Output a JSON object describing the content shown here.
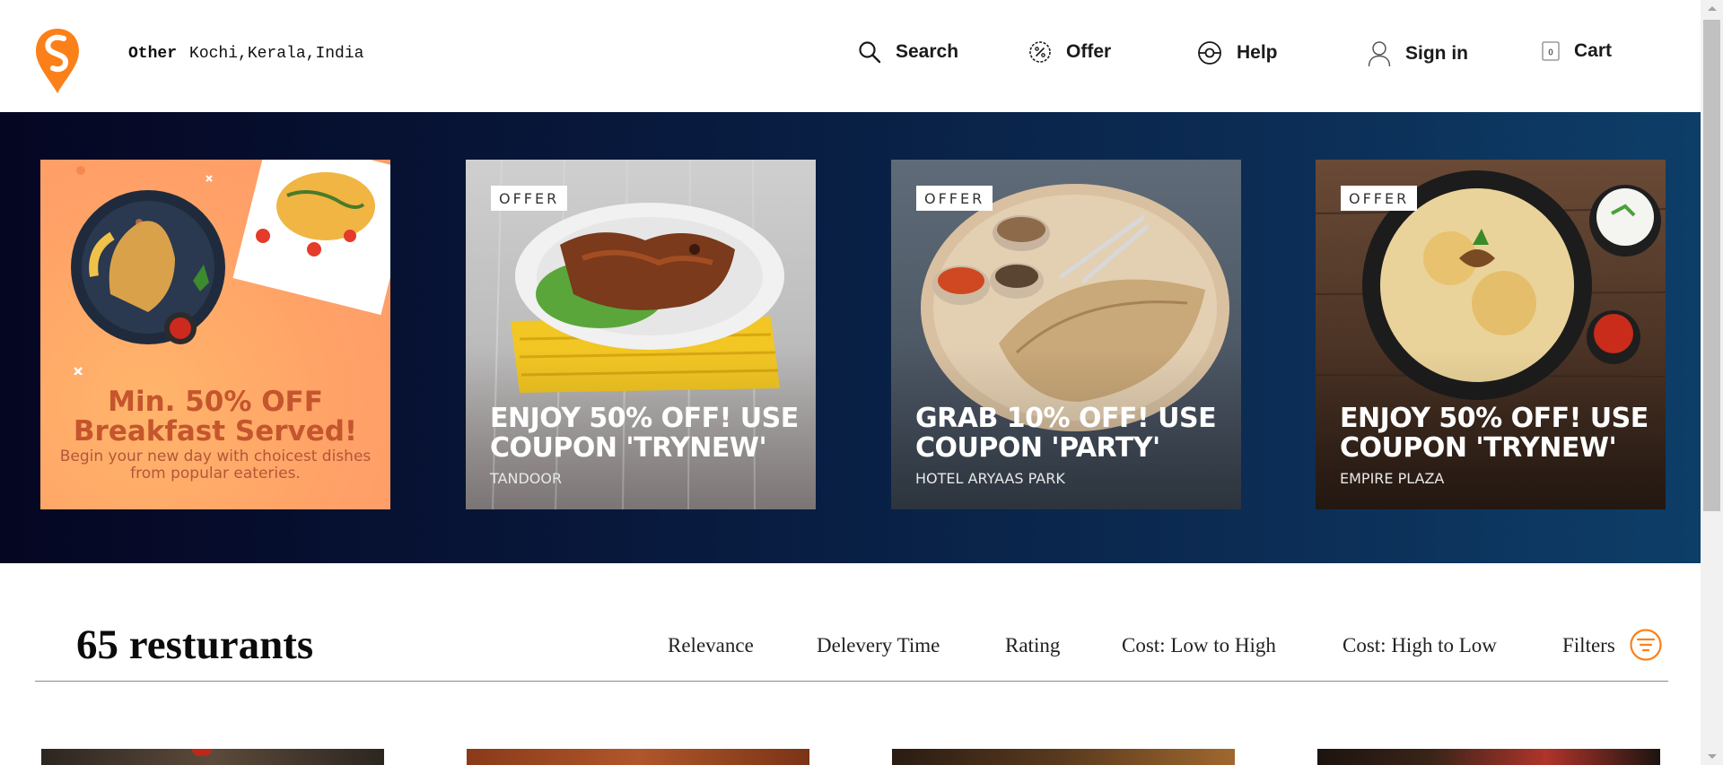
{
  "header": {
    "location_label": "Other",
    "location_value": "Kochi,Kerala,India",
    "nav": [
      {
        "label": "Search",
        "icon": "search-icon"
      },
      {
        "label": "Offer",
        "icon": "offer-icon"
      },
      {
        "label": "Help",
        "icon": "help-icon"
      },
      {
        "label": "Sign in",
        "icon": "user-icon"
      },
      {
        "label": "Cart",
        "icon": "cart-icon",
        "count": "0"
      }
    ]
  },
  "offers": [
    {
      "title": "Min. 50% OFF Breakfast Served!",
      "subtitle": "Begin your new day with choicest dishes from popular eateries."
    },
    {
      "tag": "OFFER",
      "headline": "ENJOY 50% OFF! USE COUPON 'TRYNEW'",
      "restaurant": "TANDOOR"
    },
    {
      "tag": "OFFER",
      "headline": "GRAB 10% OFF! USE COUPON 'PARTY'",
      "restaurant": "HOTEL ARYAAS PARK"
    },
    {
      "tag": "OFFER",
      "headline": "ENJOY 50% OFF! USE COUPON 'TRYNEW'",
      "restaurant": "EMPIRE PLAZA"
    }
  ],
  "listing": {
    "count_text": "65 resturants",
    "sort_options": [
      "Relevance",
      "Delevery Time",
      "Rating",
      "Cost: Low to High",
      "Cost: High to Low"
    ],
    "filters_label": "Filters"
  },
  "colors": {
    "brand": "#fc8019",
    "banner_dark": "#050622",
    "banner_light": "#0d3e68"
  }
}
